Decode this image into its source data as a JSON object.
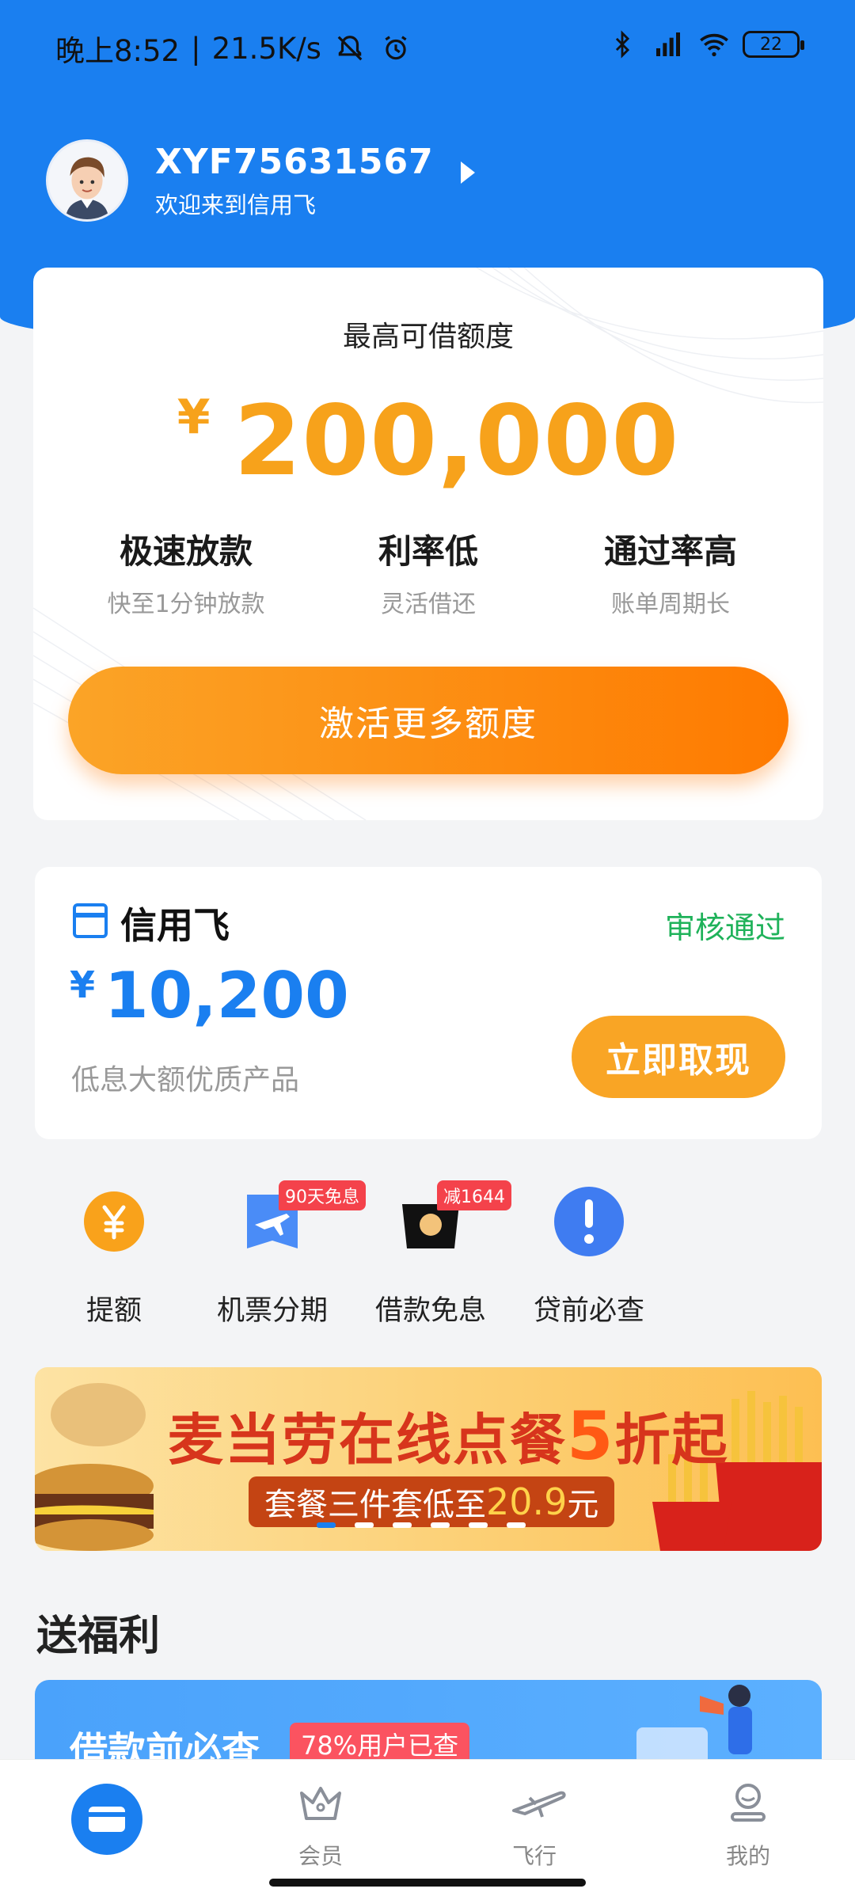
{
  "status_bar": {
    "time": "晚上8:52",
    "separator": "|",
    "net_speed": "21.5K/s",
    "battery": "22"
  },
  "user": {
    "name": "XYF75631567",
    "subtitle": "欢迎来到信用飞"
  },
  "credit": {
    "title": "最高可借额度",
    "currency": "¥",
    "amount": "200,000",
    "features": [
      {
        "title": "极速放款",
        "sub": "快至1分钟放款"
      },
      {
        "title": "利率低",
        "sub": "灵活借还"
      },
      {
        "title": "通过率高",
        "sub": "账单周期长"
      }
    ],
    "button": "激活更多额度"
  },
  "product": {
    "name": "信用飞",
    "status": "审核通过",
    "currency": "¥",
    "amount": "10,200",
    "desc": "低息大额优质产品",
    "button": "立即取现"
  },
  "quick": [
    {
      "label": "提额",
      "icon": "yen-coin-icon",
      "badge": ""
    },
    {
      "label": "机票分期",
      "icon": "airplane-ticket-icon",
      "badge": "90天免息"
    },
    {
      "label": "借款免息",
      "icon": "wallet-coin-icon",
      "badge": "减1644"
    },
    {
      "label": "贷前必查",
      "icon": "exclamation-icon",
      "badge": ""
    }
  ],
  "banner": {
    "title_pre": "麦当劳在线点餐",
    "title_num": "5",
    "title_post": "折起",
    "sub_pre": "套餐三件套低至",
    "sub_price": "20.9",
    "sub_post": "元"
  },
  "section": {
    "title": "送福利"
  },
  "welfare": {
    "title": "借款前必查",
    "badge": "78%用户已查"
  },
  "nav": [
    {
      "label": "",
      "icon": "card-icon"
    },
    {
      "label": "会员",
      "icon": "crown-icon"
    },
    {
      "label": "飞行",
      "icon": "plane-icon"
    },
    {
      "label": "我的",
      "icon": "profile-icon"
    }
  ],
  "colors": {
    "brand_blue": "#1a7ff0",
    "accent_orange": "#f7a21b",
    "success_green": "#1fb25a"
  }
}
